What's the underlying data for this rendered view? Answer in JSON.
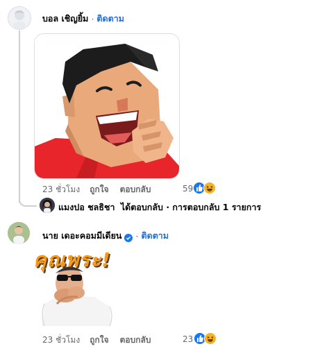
{
  "comment1": {
    "author": "บอล เชิญยิ้ม",
    "separator": "·",
    "follow_label": "ติดตาม",
    "time": "23 ชั่วโมง",
    "like_label": "ถูกใจ",
    "reply_label": "ตอบกลับ",
    "reaction_count": "59",
    "reactions": [
      "like-icon",
      "haha-icon"
    ],
    "reply_summary": {
      "author": "แมงปอ ชลธิชา",
      "text": "ได้ตอบกลับ · การตอบกลับ 1 รายการ"
    }
  },
  "comment2": {
    "author": "นาย เดอะคอมมีเดียน",
    "verified": true,
    "separator": "·",
    "follow_label": "ติดตาม",
    "sticker_text": "คุณพระ!",
    "time": "23 ชั่วโมง",
    "like_label": "ถูกใจ",
    "reply_label": "ตอบกลับ",
    "reaction_count": "23",
    "reactions": [
      "like-icon",
      "haha-icon"
    ]
  },
  "colors": {
    "link_blue": "#216fdb",
    "meta_gray": "#65676b",
    "like_blue": "#1877f2",
    "haha_yellow": "#f7b125",
    "sticker_red": "#e8252b"
  }
}
